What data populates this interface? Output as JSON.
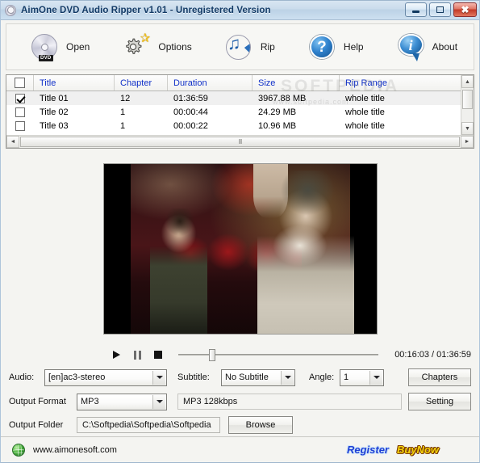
{
  "window": {
    "title": "AimOne DVD Audio Ripper v1.01 - Unregistered Version",
    "app_icon": "dvd-app-icon",
    "minimize_label": "",
    "maximize_label": "",
    "close_label": "✖"
  },
  "toolbar": {
    "items": [
      {
        "label": "Open",
        "icon": "dvd-disc-icon"
      },
      {
        "label": "Options",
        "icon": "gear-star-icon"
      },
      {
        "label": "Rip",
        "icon": "disc-music-note-icon"
      },
      {
        "label": "Help",
        "icon": "question-circle-icon"
      },
      {
        "label": "About",
        "icon": "info-bubble-icon"
      }
    ]
  },
  "title_list": {
    "columns": [
      "",
      "Title",
      "Chapter",
      "Duration",
      "Size",
      "Rip Range"
    ],
    "header_checkbox_checked": false,
    "rows": [
      {
        "checked": true,
        "title": "Title 01",
        "chapter": "12",
        "duration": "01:36:59",
        "size": "3967.88 MB",
        "rip_range": "whole title"
      },
      {
        "checked": false,
        "title": "Title 02",
        "chapter": "1",
        "duration": "00:00:44",
        "size": "24.29 MB",
        "rip_range": "whole title"
      },
      {
        "checked": false,
        "title": "Title 03",
        "chapter": "1",
        "duration": "00:00:22",
        "size": "10.96 MB",
        "rip_range": "whole title"
      }
    ],
    "watermark": "SOFTPEDIA",
    "watermark_small": "www.softpedia.com",
    "scroll_up_glyph": "▲",
    "scroll_down_glyph": "▼",
    "scroll_left_glyph": "◄",
    "scroll_right_glyph": "►",
    "hthumb_grip": "III"
  },
  "player": {
    "play_label": "",
    "pause_label": "",
    "stop_label": "",
    "seek_percent": 17,
    "time_display": "00:16:03 / 01:36:59"
  },
  "options": {
    "audio_label": "Audio:",
    "audio_value": "[en]ac3-stereo",
    "subtitle_label": "Subtitle:",
    "subtitle_value": "No Subtitle",
    "angle_label": "Angle:",
    "angle_value": "1",
    "chapters_button": "Chapters"
  },
  "output": {
    "format_label": "Output Format",
    "format_value": "MP3",
    "format_info": "MP3  128kbps",
    "setting_button": "Setting",
    "folder_label": "Output Folder",
    "folder_value": "C:\\Softpedia\\Softpedia\\Softpedia",
    "browse_button": "Browse"
  },
  "status": {
    "site_icon": "globe-icon",
    "site": "www.aimonesoft.com",
    "register": "Register",
    "buynow": "BuyNow"
  },
  "colors": {
    "header_text": "#1030c8",
    "title_text": "#123a66",
    "register": "#1f40d6",
    "buynow": "#f5d30a",
    "close_button": "#c43a27"
  }
}
